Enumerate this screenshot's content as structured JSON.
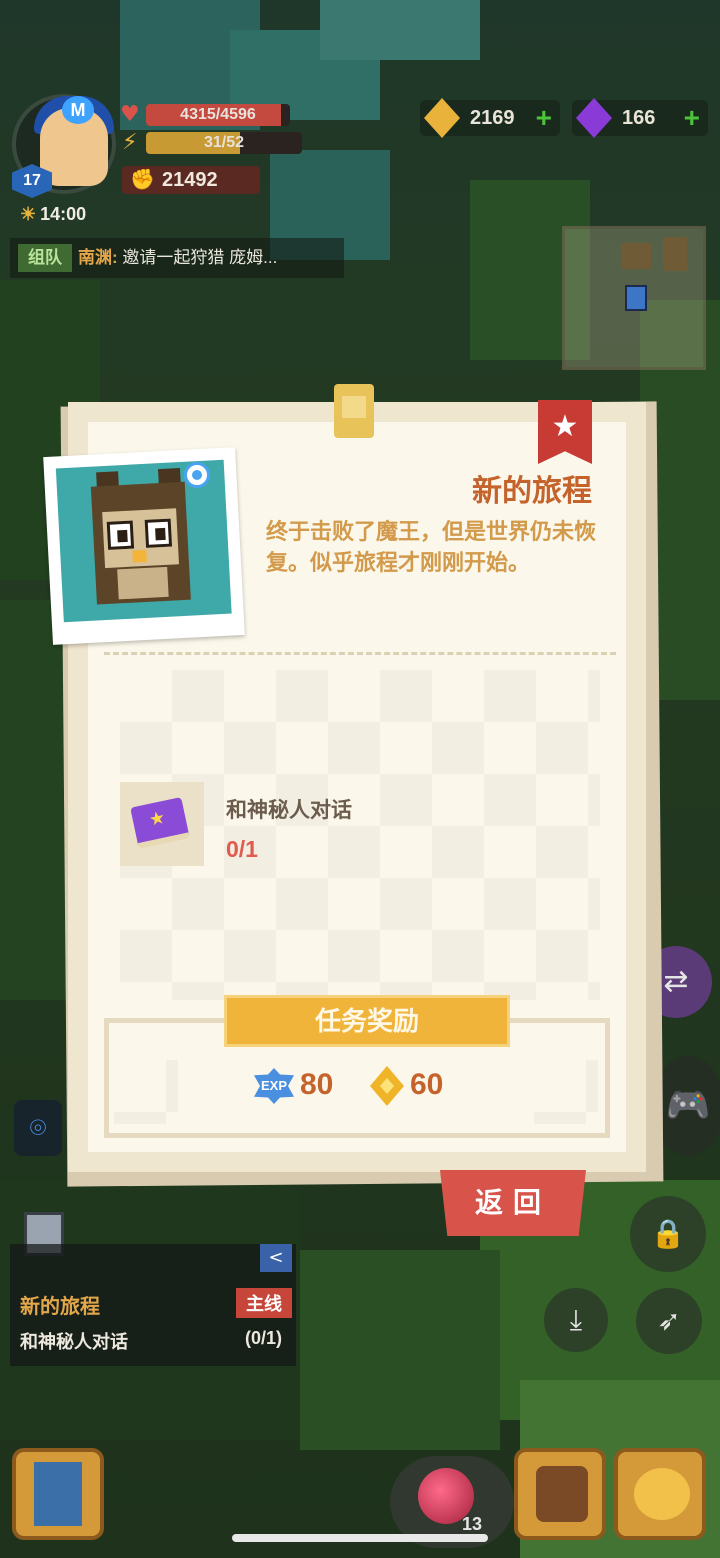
{
  "hud": {
    "level": "17",
    "hp_text": "4315/4596",
    "hp_fraction": 0.94,
    "energy_text": "31/52",
    "energy_fraction": 0.6,
    "power": "21492",
    "time": "14:00",
    "avatar_letter": "M"
  },
  "currency": {
    "gold": "2169",
    "gems": "166",
    "plus": "+"
  },
  "chat": {
    "channel": "组队",
    "sender": "南渊:",
    "message": "邀请一起狩猎 庞姆..."
  },
  "quest_dialog": {
    "title": "新的旅程",
    "description": "终于击败了魔王，但是世界仍未恢复。似乎旅程才刚刚开始。",
    "objective": "和神秘人对话",
    "progress": "0/1",
    "reward_header": "任务奖励",
    "reward_exp_label": "EXP",
    "reward_exp": "80",
    "reward_gold": "60",
    "back_label": "返回"
  },
  "tracker": {
    "title": "新的旅程",
    "tag": "主线",
    "objective": "和神秘人对话",
    "progress": "(0/1)",
    "collapse": "<"
  },
  "bottom": {
    "potion_count": "13"
  },
  "colors": {
    "accent_title": "#c4632c",
    "progress_red": "#e05a4e",
    "reward_gold": "#f0b43a",
    "back_red": "#d8534a"
  }
}
